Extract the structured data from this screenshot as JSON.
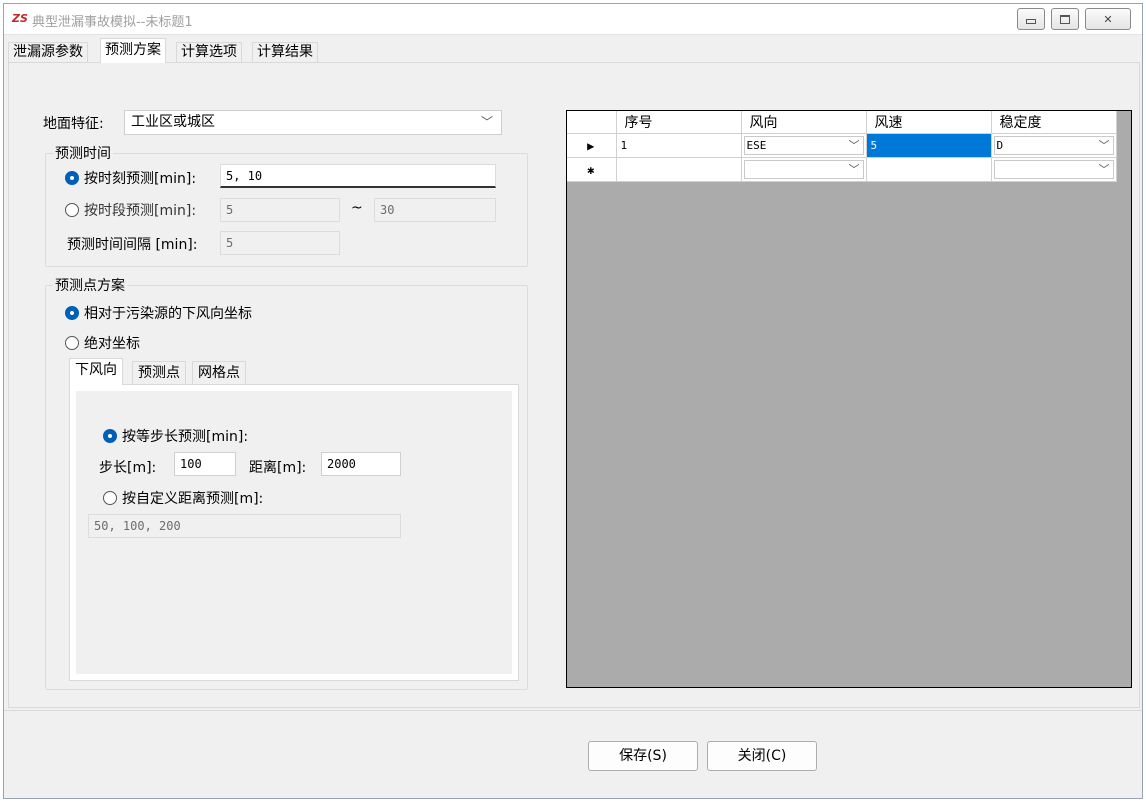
{
  "window": {
    "title": "典型泄漏事故模拟--未标题1",
    "app_icon_text": "ZS"
  },
  "tabs": [
    "泄漏源参数",
    "预测方案",
    "计算选项",
    "计算结果"
  ],
  "active_tab": "预测方案",
  "ground": {
    "label": "地面特征:",
    "value": "工业区或城区"
  },
  "forecast_time": {
    "group_title": "预测时间",
    "by_moment_label": "按时刻预测[min]:",
    "by_moment_value": "5, 10",
    "by_period_label": "按时段预测[min]:",
    "period_from": "5",
    "tilde": "~",
    "period_to": "30",
    "interval_label": "预测时间间隔 [min]:",
    "interval_value": "5",
    "selected": "by_moment"
  },
  "point_scheme": {
    "group_title": "预测点方案",
    "relative_label": "相对于污染源的下风向坐标",
    "absolute_label": "绝对坐标",
    "selected": "relative",
    "inner_tabs": [
      "下风向",
      "预测点",
      "网格点"
    ],
    "active_inner_tab": "下风向",
    "step_radio_label": "按等步长预测[min]:",
    "step_label": "步长[m]:",
    "step_value": "100",
    "distance_label": "距离[m]:",
    "distance_value": "2000",
    "custom_radio_label": "按自定义距离预测[m]:",
    "custom_value": "50, 100, 200"
  },
  "grid": {
    "columns": [
      "序号",
      "风向",
      "风速",
      "稳定度"
    ],
    "rows": [
      {
        "indicator": "▶",
        "seq": "1",
        "direction": "ESE",
        "speed": "5",
        "stability": "D"
      },
      {
        "indicator": "✱",
        "seq": "",
        "direction": "",
        "speed": "",
        "stability": ""
      }
    ]
  },
  "buttons": {
    "save": "保存(S)",
    "close": "关闭(C)"
  },
  "colors": {
    "accent": "#0078d7",
    "grid_background": "#ababab"
  }
}
